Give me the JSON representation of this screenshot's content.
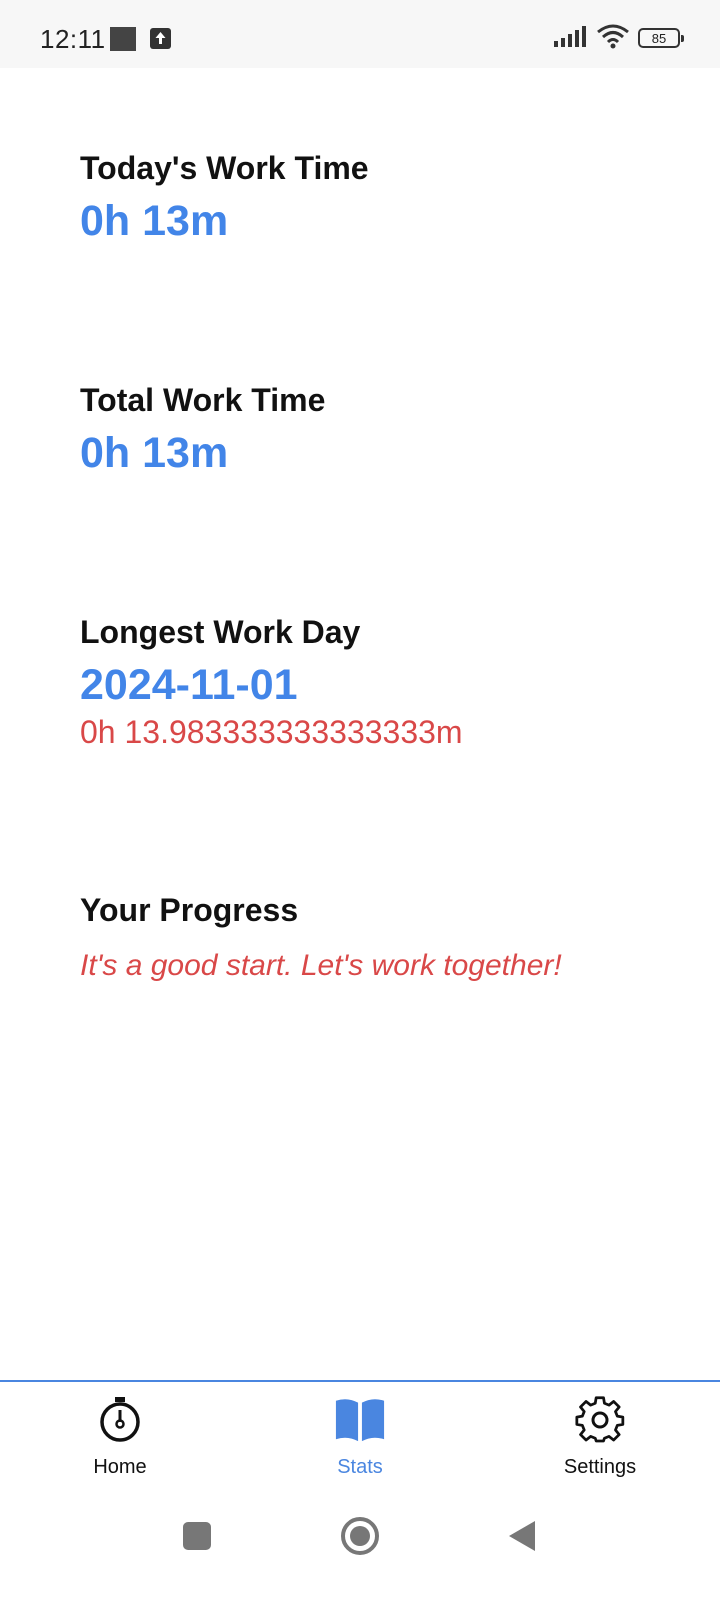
{
  "status_bar": {
    "time": "12:11",
    "battery": "85",
    "icons": [
      "notification-square-icon",
      "upload-icon",
      "signal-icon",
      "wifi-icon",
      "battery-icon"
    ]
  },
  "stats": {
    "today": {
      "title": "Today's Work Time",
      "value": "0h 13m"
    },
    "total": {
      "title": "Total Work Time",
      "value": "0h 13m"
    },
    "longest": {
      "title": "Longest Work Day",
      "date": "2024-11-01",
      "duration": "0h 13.983333333333333m"
    },
    "progress": {
      "title": "Your Progress",
      "message": "It's a good start. Let's work together!"
    }
  },
  "bottom_nav": {
    "items": [
      {
        "label": "Home",
        "icon": "stopwatch-icon",
        "active": false
      },
      {
        "label": "Stats",
        "icon": "book-icon",
        "active": true
      },
      {
        "label": "Settings",
        "icon": "gear-icon",
        "active": false
      }
    ]
  },
  "system_nav": {
    "icons": [
      "recents-square-icon",
      "home-circle-icon",
      "back-triangle-icon"
    ]
  },
  "colors": {
    "accent": "#4285e8",
    "highlight_red": "#d94848",
    "nav_active": "#4a86e0"
  }
}
